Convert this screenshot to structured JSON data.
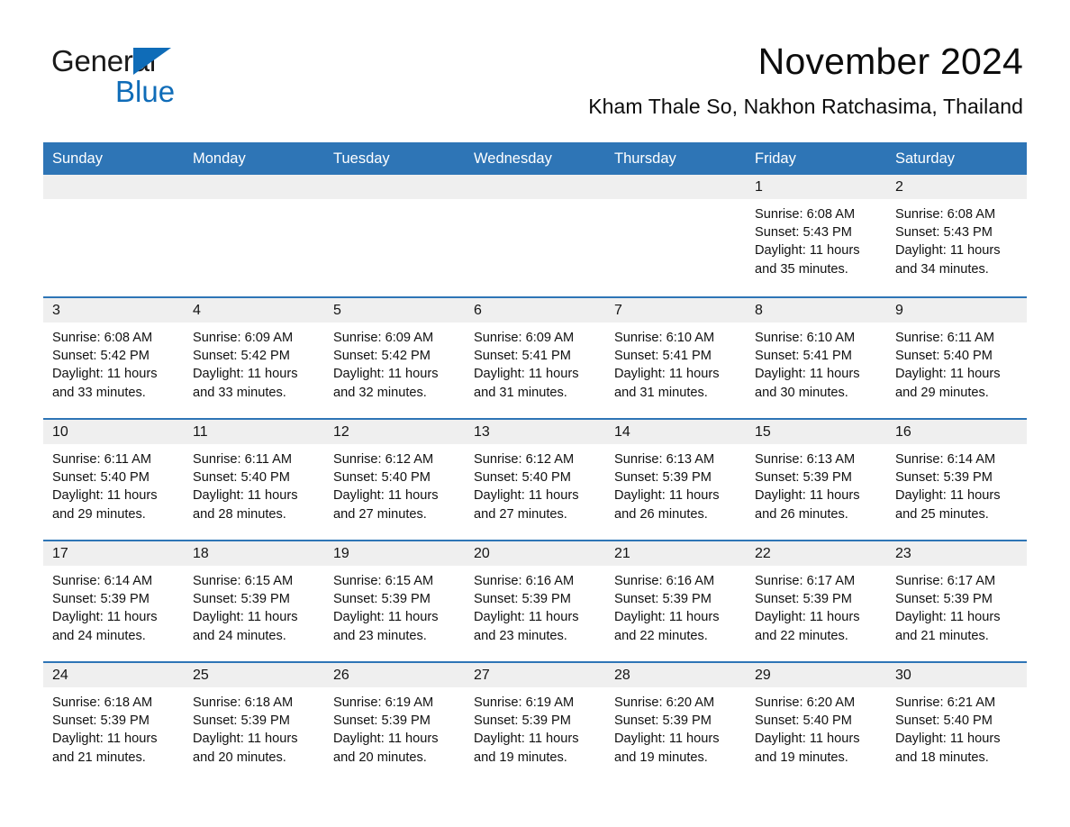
{
  "brand": {
    "name_line1": "General",
    "name_line2": "Blue",
    "accent_color": "#0f6cb8"
  },
  "header": {
    "title": "November 2024",
    "subtitle": "Kham Thale So, Nakhon Ratchasima, Thailand"
  },
  "theme": {
    "header_bar_color": "#2e75b6",
    "daynum_band_color": "#efefef",
    "week_separator_color": "#2e75b6",
    "text_color": "#111111"
  },
  "calendar": {
    "weekday_headers": [
      "Sunday",
      "Monday",
      "Tuesday",
      "Wednesday",
      "Thursday",
      "Friday",
      "Saturday"
    ],
    "weeks": [
      [
        {
          "day": "",
          "details": ""
        },
        {
          "day": "",
          "details": ""
        },
        {
          "day": "",
          "details": ""
        },
        {
          "day": "",
          "details": ""
        },
        {
          "day": "",
          "details": ""
        },
        {
          "day": "1",
          "details": "Sunrise: 6:08 AM\nSunset: 5:43 PM\nDaylight: 11 hours\nand 35 minutes."
        },
        {
          "day": "2",
          "details": "Sunrise: 6:08 AM\nSunset: 5:43 PM\nDaylight: 11 hours\nand 34 minutes."
        }
      ],
      [
        {
          "day": "3",
          "details": "Sunrise: 6:08 AM\nSunset: 5:42 PM\nDaylight: 11 hours\nand 33 minutes."
        },
        {
          "day": "4",
          "details": "Sunrise: 6:09 AM\nSunset: 5:42 PM\nDaylight: 11 hours\nand 33 minutes."
        },
        {
          "day": "5",
          "details": "Sunrise: 6:09 AM\nSunset: 5:42 PM\nDaylight: 11 hours\nand 32 minutes."
        },
        {
          "day": "6",
          "details": "Sunrise: 6:09 AM\nSunset: 5:41 PM\nDaylight: 11 hours\nand 31 minutes."
        },
        {
          "day": "7",
          "details": "Sunrise: 6:10 AM\nSunset: 5:41 PM\nDaylight: 11 hours\nand 31 minutes."
        },
        {
          "day": "8",
          "details": "Sunrise: 6:10 AM\nSunset: 5:41 PM\nDaylight: 11 hours\nand 30 minutes."
        },
        {
          "day": "9",
          "details": "Sunrise: 6:11 AM\nSunset: 5:40 PM\nDaylight: 11 hours\nand 29 minutes."
        }
      ],
      [
        {
          "day": "10",
          "details": "Sunrise: 6:11 AM\nSunset: 5:40 PM\nDaylight: 11 hours\nand 29 minutes."
        },
        {
          "day": "11",
          "details": "Sunrise: 6:11 AM\nSunset: 5:40 PM\nDaylight: 11 hours\nand 28 minutes."
        },
        {
          "day": "12",
          "details": "Sunrise: 6:12 AM\nSunset: 5:40 PM\nDaylight: 11 hours\nand 27 minutes."
        },
        {
          "day": "13",
          "details": "Sunrise: 6:12 AM\nSunset: 5:40 PM\nDaylight: 11 hours\nand 27 minutes."
        },
        {
          "day": "14",
          "details": "Sunrise: 6:13 AM\nSunset: 5:39 PM\nDaylight: 11 hours\nand 26 minutes."
        },
        {
          "day": "15",
          "details": "Sunrise: 6:13 AM\nSunset: 5:39 PM\nDaylight: 11 hours\nand 26 minutes."
        },
        {
          "day": "16",
          "details": "Sunrise: 6:14 AM\nSunset: 5:39 PM\nDaylight: 11 hours\nand 25 minutes."
        }
      ],
      [
        {
          "day": "17",
          "details": "Sunrise: 6:14 AM\nSunset: 5:39 PM\nDaylight: 11 hours\nand 24 minutes."
        },
        {
          "day": "18",
          "details": "Sunrise: 6:15 AM\nSunset: 5:39 PM\nDaylight: 11 hours\nand 24 minutes."
        },
        {
          "day": "19",
          "details": "Sunrise: 6:15 AM\nSunset: 5:39 PM\nDaylight: 11 hours\nand 23 minutes."
        },
        {
          "day": "20",
          "details": "Sunrise: 6:16 AM\nSunset: 5:39 PM\nDaylight: 11 hours\nand 23 minutes."
        },
        {
          "day": "21",
          "details": "Sunrise: 6:16 AM\nSunset: 5:39 PM\nDaylight: 11 hours\nand 22 minutes."
        },
        {
          "day": "22",
          "details": "Sunrise: 6:17 AM\nSunset: 5:39 PM\nDaylight: 11 hours\nand 22 minutes."
        },
        {
          "day": "23",
          "details": "Sunrise: 6:17 AM\nSunset: 5:39 PM\nDaylight: 11 hours\nand 21 minutes."
        }
      ],
      [
        {
          "day": "24",
          "details": "Sunrise: 6:18 AM\nSunset: 5:39 PM\nDaylight: 11 hours\nand 21 minutes."
        },
        {
          "day": "25",
          "details": "Sunrise: 6:18 AM\nSunset: 5:39 PM\nDaylight: 11 hours\nand 20 minutes."
        },
        {
          "day": "26",
          "details": "Sunrise: 6:19 AM\nSunset: 5:39 PM\nDaylight: 11 hours\nand 20 minutes."
        },
        {
          "day": "27",
          "details": "Sunrise: 6:19 AM\nSunset: 5:39 PM\nDaylight: 11 hours\nand 19 minutes."
        },
        {
          "day": "28",
          "details": "Sunrise: 6:20 AM\nSunset: 5:39 PM\nDaylight: 11 hours\nand 19 minutes."
        },
        {
          "day": "29",
          "details": "Sunrise: 6:20 AM\nSunset: 5:40 PM\nDaylight: 11 hours\nand 19 minutes."
        },
        {
          "day": "30",
          "details": "Sunrise: 6:21 AM\nSunset: 5:40 PM\nDaylight: 11 hours\nand 18 minutes."
        }
      ]
    ]
  }
}
